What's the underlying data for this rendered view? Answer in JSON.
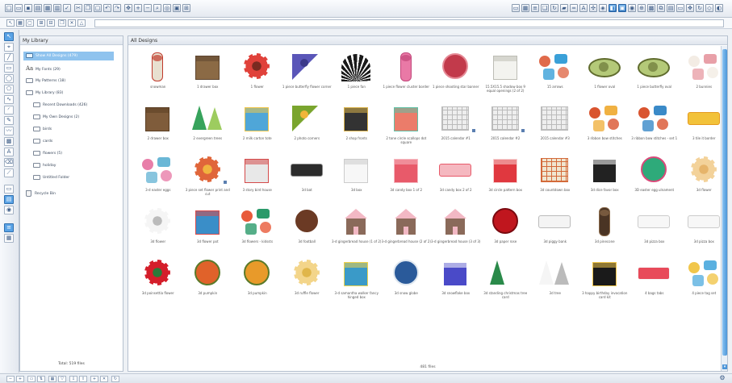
{
  "library": {
    "header": "My Library",
    "items": [
      {
        "label": "Show All Designs (479)",
        "selected": true,
        "icon": "library-icon"
      },
      {
        "label": "My Fonts (29)",
        "selected": false,
        "icon": "font-icon"
      },
      {
        "label": "My Patterns (18)",
        "selected": false,
        "icon": "folder-icon"
      },
      {
        "label": "My Library (83)",
        "selected": false,
        "icon": "folder-icon"
      },
      {
        "label": "Recent Downloads (426)",
        "selected": false,
        "icon": "folder-icon"
      },
      {
        "label": "My Own Designs (2)",
        "selected": false,
        "icon": "folder-icon"
      },
      {
        "label": "birds",
        "selected": false,
        "icon": "folder-icon"
      },
      {
        "label": "cards",
        "selected": false,
        "icon": "folder-icon"
      },
      {
        "label": "flowers (5)",
        "selected": false,
        "icon": "folder-icon"
      },
      {
        "label": "holiday",
        "selected": false,
        "icon": "folder-icon"
      },
      {
        "label": "Untitled Folder",
        "selected": false,
        "icon": "folder-icon"
      },
      {
        "label": "Recycle Bin",
        "selected": false,
        "icon": "trash-icon"
      }
    ],
    "footer": "Total: 519 files"
  },
  "designs": {
    "header": "All Designs",
    "count": "481 files",
    "items": [
      {
        "caption": "snowman",
        "color": "#e8e0d0",
        "accent": "#c0392b",
        "shape": "tall"
      },
      {
        "caption": "1 drawer box",
        "color": "#8b6a45",
        "accent": "#5e4630",
        "shape": "box"
      },
      {
        "caption": "1 flower",
        "color": "#e0413a",
        "accent": "#7a2a20",
        "shape": "flower"
      },
      {
        "caption": "1 piece butterfly flower corner",
        "color": "#5a56b8",
        "accent": "#3c3a8a",
        "shape": "corner"
      },
      {
        "caption": "1 piece fan",
        "color": "#1a1a1a",
        "accent": "#ffffff",
        "shape": "fan"
      },
      {
        "caption": "1 piece flower cluster border",
        "color": "#e979a6",
        "accent": "#c2477b",
        "shape": "tall"
      },
      {
        "caption": "1 piece shooting star banner",
        "color": "#c23a4b",
        "accent": "#e58a96",
        "shape": "round"
      },
      {
        "caption": "15.5X15.5 shadow box 9 equal openings (2 of 2)",
        "color": "#f3f3ef",
        "accent": "#bdbdb5",
        "shape": "box"
      },
      {
        "caption": "15 arrows",
        "color": "#e06a4a",
        "accent": "#3aa0d8",
        "shape": "multi"
      },
      {
        "caption": "1 flower oval",
        "color": "#b4c978",
        "accent": "#5f6b2d",
        "shape": "oval"
      },
      {
        "caption": "1 piece butterfly oval",
        "color": "#b4c978",
        "accent": "#5f6b2d",
        "shape": "oval"
      },
      {
        "caption": "2 bunnies",
        "color": "#f3ece4",
        "accent": "#e8a0a8",
        "shape": "multi"
      },
      {
        "caption": "2 drawer box",
        "color": "#7f5c3b",
        "accent": "#5b3f25",
        "shape": "box"
      },
      {
        "caption": "2 evergreen trees",
        "color": "#37a35c",
        "accent": "#9dcc5f",
        "shape": "tree"
      },
      {
        "caption": "2 milk carton tote",
        "color": "#4fa6d8",
        "accent": "#f1c64b",
        "shape": "box"
      },
      {
        "caption": "2 photo corners",
        "color": "#7aa52e",
        "accent": "#f0b53a",
        "shape": "corner"
      },
      {
        "caption": "2 shop fronts",
        "color": "#333333",
        "accent": "#d9b24a",
        "shape": "box"
      },
      {
        "caption": "2 tone circle scallops dot square",
        "color": "#eb7c6a",
        "accent": "#5fc0a6",
        "shape": "box"
      },
      {
        "caption": "2015 calendar #1",
        "color": "#eeeeee",
        "accent": "#bbbbbb",
        "shape": "grid"
      },
      {
        "caption": "2015 calendar #2",
        "color": "#eeeeee",
        "accent": "#bbbbbb",
        "shape": "grid"
      },
      {
        "caption": "2015 calendar #3",
        "color": "#eeeeee",
        "accent": "#bbbbbb",
        "shape": "grid"
      },
      {
        "caption": "3 ribbon bow stitches",
        "color": "#d9542f",
        "accent": "#f0b142",
        "shape": "multi"
      },
      {
        "caption": "3 ribbon bow stitches - set 1",
        "color": "#d9542f",
        "accent": "#3a8ac8",
        "shape": "multi"
      },
      {
        "caption": "3 tile it border",
        "color": "#f2c23a",
        "accent": "#e59a1f",
        "shape": "wide"
      },
      {
        "caption": "3-d easter eggs",
        "color": "#e87ea9",
        "accent": "#6ab7d6",
        "shape": "multi"
      },
      {
        "caption": "3 piece set flower print and cut",
        "color": "#e0663a",
        "accent": "#f1b43f",
        "shape": "flower"
      },
      {
        "caption": "3 story bird house",
        "color": "#e8e8e8",
        "accent": "#d44a4a",
        "shape": "box"
      },
      {
        "caption": "3d bat",
        "color": "#2c2c2c",
        "accent": "#888888",
        "shape": "wide"
      },
      {
        "caption": "3d box",
        "color": "#f7f7f7",
        "accent": "#cccccc",
        "shape": "box"
      },
      {
        "caption": "3d candy box 1 of 2",
        "color": "#e85a6a",
        "accent": "#f5b8c0",
        "shape": "box"
      },
      {
        "caption": "3d candy box 2 of 2",
        "color": "#f5b8c0",
        "accent": "#e85a6a",
        "shape": "wide"
      },
      {
        "caption": "3d circle pattern box",
        "color": "#e0383f",
        "accent": "#f7d0d0",
        "shape": "box"
      },
      {
        "caption": "3d countdown box",
        "color": "#f0e6d0",
        "accent": "#d36a3a",
        "shape": "grid"
      },
      {
        "caption": "3d dice favor box",
        "color": "#222222",
        "accent": "#ffffff",
        "shape": "box"
      },
      {
        "caption": "3D easter egg ulnament",
        "color": "#2eaa7a",
        "accent": "#d94a7a",
        "shape": "round"
      },
      {
        "caption": "3d flower",
        "color": "#f3d29a",
        "accent": "#e6b46a",
        "shape": "flower"
      },
      {
        "caption": "3d flower",
        "color": "#f5f5f5",
        "accent": "#bbbbbb",
        "shape": "flower"
      },
      {
        "caption": "3d flower pot",
        "color": "#3a8ec8",
        "accent": "#d94a4a",
        "shape": "box"
      },
      {
        "caption": "3d flowers - kidssts",
        "color": "#e85a3a",
        "accent": "#2a9a6a",
        "shape": "multi"
      },
      {
        "caption": "3d football",
        "color": "#6b3a24",
        "accent": "#ffffff",
        "shape": "round"
      },
      {
        "caption": "3-d gingerbread house (1 of 2)",
        "color": "#8a6a5a",
        "accent": "#f2b8c4",
        "shape": "house"
      },
      {
        "caption": "3-d gingerbread house (2 of 2)",
        "color": "#8a6a5a",
        "accent": "#f2b8c4",
        "shape": "house"
      },
      {
        "caption": "3-d gingerbread house (3 of 3)",
        "color": "#8a6a5a",
        "accent": "#f2b8c4",
        "shape": "house"
      },
      {
        "caption": "3d paper rose",
        "color": "#c0161e",
        "accent": "#7a0a10",
        "shape": "round"
      },
      {
        "caption": "3d piggy bank",
        "color": "#f4f4f4",
        "accent": "#bbbbbb",
        "shape": "wide"
      },
      {
        "caption": "3d pinecone",
        "color": "#4a3424",
        "accent": "#8a6a4a",
        "shape": "tall"
      },
      {
        "caption": "3d pizza box",
        "color": "#f7f7f7",
        "accent": "#cccccc",
        "shape": "wide"
      },
      {
        "caption": "3d pizza box",
        "color": "#f7f7f7",
        "accent": "#cccccc",
        "shape": "wide"
      },
      {
        "caption": "3d poinsettia flower",
        "color": "#d41e2a",
        "accent": "#2a7a3a",
        "shape": "flower"
      },
      {
        "caption": "3d pumpkin",
        "color": "#e0622a",
        "accent": "#5a7a2a",
        "shape": "round"
      },
      {
        "caption": "3d pumpkin",
        "color": "#e89a2a",
        "accent": "#5a7a2a",
        "shape": "round"
      },
      {
        "caption": "3d ruffle flower",
        "color": "#f3d58a",
        "accent": "#e0b64a",
        "shape": "flower"
      },
      {
        "caption": "3-d samantha walker fancy hinged box",
        "color": "#3a9ac8",
        "accent": "#f1d24a",
        "shape": "box"
      },
      {
        "caption": "3d snow globe",
        "color": "#2a5a9a",
        "accent": "#e0e8f0",
        "shape": "round"
      },
      {
        "caption": "3d snowflake box",
        "color": "#4a4ac8",
        "accent": "#ffffff",
        "shape": "box"
      },
      {
        "caption": "3d standing christmas tree card",
        "color": "#2a8a4a",
        "accent": "#ffffff",
        "shape": "tree"
      },
      {
        "caption": "3d tree",
        "color": "#f5f5f5",
        "accent": "#bbbbbb",
        "shape": "tree"
      },
      {
        "caption": "3 happy birthday invocation card kit",
        "color": "#1a1a1a",
        "accent": "#f1c64b",
        "shape": "box"
      },
      {
        "caption": "4 bags tabs",
        "color": "#e84a5a",
        "accent": "#f5f5f5",
        "shape": "wide"
      },
      {
        "caption": "4 piece tag set",
        "color": "#f1c64b",
        "accent": "#5ab0e0",
        "shape": "multi"
      }
    ]
  },
  "colors": {
    "accent": "#5aa3e6",
    "selection": "#8fc3ee"
  }
}
